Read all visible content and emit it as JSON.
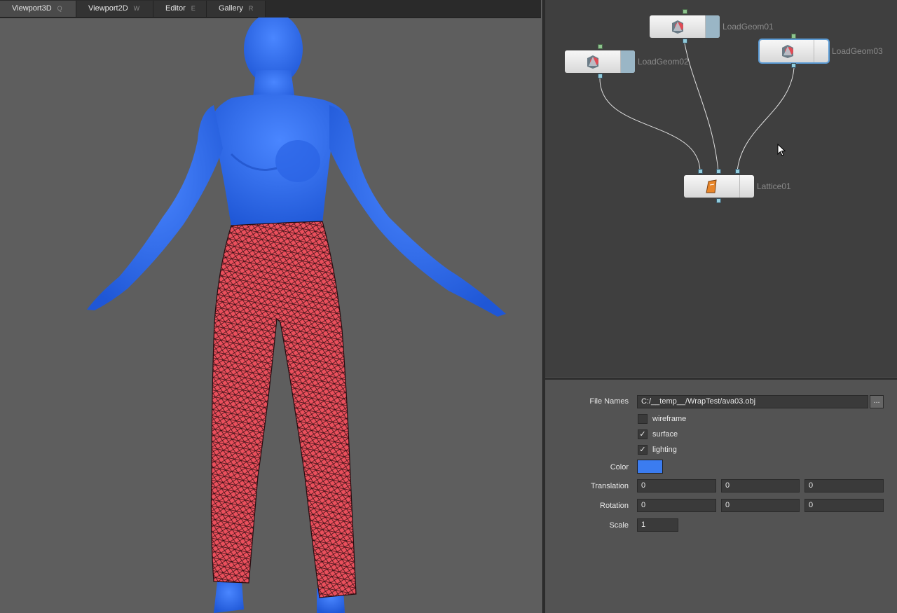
{
  "tabs": [
    {
      "label": "Viewport3D",
      "key": "Q"
    },
    {
      "label": "Viewport2D",
      "key": "W"
    },
    {
      "label": "Editor",
      "key": "E"
    },
    {
      "label": "Gallery",
      "key": "R"
    }
  ],
  "nodes": {
    "loadgeom01": {
      "label": "LoadGeom01"
    },
    "loadgeom02": {
      "label": "LoadGeom02"
    },
    "loadgeom03": {
      "label": "LoadGeom03"
    },
    "lattice01": {
      "label": "Lattice01"
    }
  },
  "properties": {
    "file_names_label": "File Names",
    "file_names_value": "C:/__temp__/WrapTest/ava03.obj",
    "browse_label": "...",
    "wireframe_label": "wireframe",
    "wireframe_checked": false,
    "surface_label": "surface",
    "surface_checked": true,
    "lighting_label": "lighting",
    "lighting_checked": true,
    "color_label": "Color",
    "color_value": "#3b7cf0",
    "translation_label": "Translation",
    "translation": [
      "0",
      "0",
      "0"
    ],
    "rotation_label": "Rotation",
    "rotation": [
      "0",
      "0",
      "0"
    ],
    "scale_label": "Scale",
    "scale": "1"
  },
  "colors": {
    "body": "#2f6ef0",
    "garment": "#e8505c",
    "viewport_bg": "#5e5e5e"
  }
}
